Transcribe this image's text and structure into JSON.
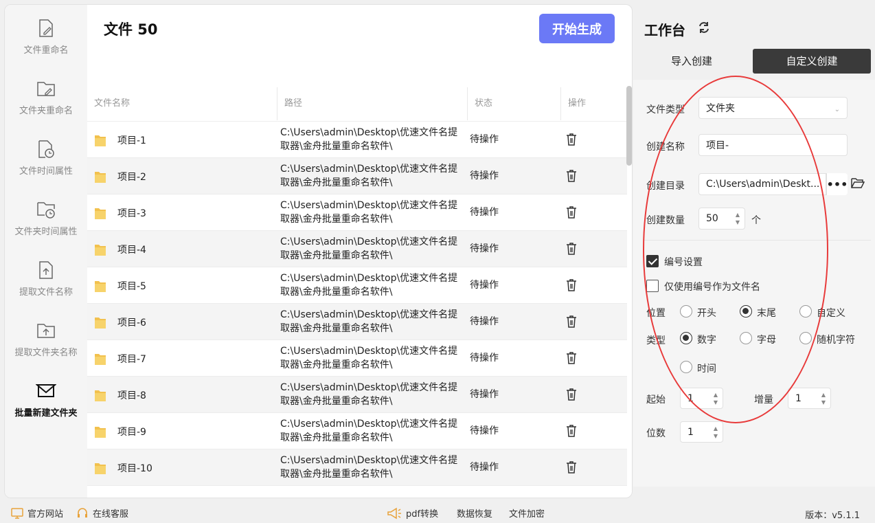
{
  "sidebar": {
    "items": [
      {
        "label": "文件重命名",
        "icon": "file-edit-icon"
      },
      {
        "label": "文件夹重命名",
        "icon": "folder-edit-icon"
      },
      {
        "label": "文件时间属性",
        "icon": "file-clock-icon"
      },
      {
        "label": "文件夹时间属性",
        "icon": "folder-clock-icon"
      },
      {
        "label": "提取文件名称",
        "icon": "file-upload-icon"
      },
      {
        "label": "提取文件夹名称",
        "icon": "folder-upload-icon"
      },
      {
        "label": "批量新建文件夹",
        "icon": "mail-icon",
        "active": true
      }
    ]
  },
  "header": {
    "title": "文件 50",
    "start_label": "开始生成"
  },
  "table": {
    "columns": [
      "文件名称",
      "路径",
      "状态",
      "操作"
    ],
    "rows": [
      {
        "name": "项目-1",
        "path": "C:\\Users\\admin\\Desktop\\优速文件名提取器\\金舟批量重命名软件\\",
        "status": "待操作"
      },
      {
        "name": "项目-2",
        "path": "C:\\Users\\admin\\Desktop\\优速文件名提取器\\金舟批量重命名软件\\",
        "status": "待操作"
      },
      {
        "name": "项目-3",
        "path": "C:\\Users\\admin\\Desktop\\优速文件名提取器\\金舟批量重命名软件\\",
        "status": "待操作"
      },
      {
        "name": "项目-4",
        "path": "C:\\Users\\admin\\Desktop\\优速文件名提取器\\金舟批量重命名软件\\",
        "status": "待操作"
      },
      {
        "name": "项目-5",
        "path": "C:\\Users\\admin\\Desktop\\优速文件名提取器\\金舟批量重命名软件\\",
        "status": "待操作"
      },
      {
        "name": "项目-6",
        "path": "C:\\Users\\admin\\Desktop\\优速文件名提取器\\金舟批量重命名软件\\",
        "status": "待操作"
      },
      {
        "name": "项目-7",
        "path": "C:\\Users\\admin\\Desktop\\优速文件名提取器\\金舟批量重命名软件\\",
        "status": "待操作"
      },
      {
        "name": "项目-8",
        "path": "C:\\Users\\admin\\Desktop\\优速文件名提取器\\金舟批量重命名软件\\",
        "status": "待操作"
      },
      {
        "name": "项目-9",
        "path": "C:\\Users\\admin\\Desktop\\优速文件名提取器\\金舟批量重命名软件\\",
        "status": "待操作"
      },
      {
        "name": "项目-10",
        "path": "C:\\Users\\admin\\Desktop\\优速文件名提取器\\金舟批量重命名软件\\",
        "status": "待操作"
      }
    ]
  },
  "workbench": {
    "title": "工作台",
    "tabs": {
      "import": "导入创建",
      "custom": "自定义创建"
    },
    "file_type": {
      "label": "文件类型",
      "value": "文件夹"
    },
    "create_name": {
      "label": "创建名称",
      "value": "项目-"
    },
    "create_dir": {
      "label": "创建目录",
      "value": "C:\\Users\\admin\\Deskt...",
      "browse": "•••"
    },
    "create_count": {
      "label": "创建数量",
      "value": "50",
      "unit": "个"
    },
    "numbering": {
      "label": "编号设置",
      "checked": true
    },
    "only_number": {
      "label": "仅使用编号作为文件名",
      "checked": false
    },
    "position": {
      "label": "位置",
      "options": [
        "开头",
        "末尾",
        "自定义"
      ],
      "selected": "末尾"
    },
    "type": {
      "label": "类型",
      "options": [
        "数字",
        "字母",
        "随机字符",
        "时间"
      ],
      "selected": "数字"
    },
    "start": {
      "label": "起始",
      "value": "1"
    },
    "increment": {
      "label": "增量",
      "value": "1"
    },
    "digits": {
      "label": "位数",
      "value": "1"
    }
  },
  "footer": {
    "website": "官方网站",
    "support": "在线客服",
    "pdf": "pdf转换",
    "recovery": "数据恢复",
    "encrypt": "文件加密",
    "version": "版本：v5.1.1"
  },
  "colors": {
    "accent": "#6b79f6",
    "annotation": "#e83a3a",
    "active_tab": "#3a3a3a"
  }
}
